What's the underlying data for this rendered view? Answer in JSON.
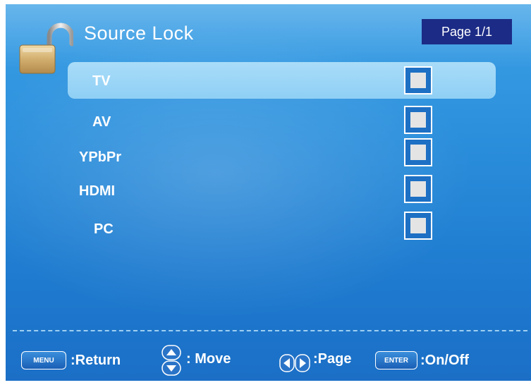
{
  "header": {
    "title": "Source Lock",
    "page_indicator": "Page 1/1"
  },
  "sources": [
    {
      "label": "TV",
      "selected": true,
      "locked": false
    },
    {
      "label": "AV",
      "selected": false,
      "locked": false
    },
    {
      "label": "YPbPr",
      "selected": false,
      "locked": false
    },
    {
      "label": "HDMI",
      "selected": false,
      "locked": false
    },
    {
      "label": "PC",
      "selected": false,
      "locked": false
    }
  ],
  "footer": {
    "menu_key": "MENU",
    "menu_action": ":Return",
    "move_action": ": Move",
    "page_action": ":Page",
    "enter_key": "ENTER",
    "enter_action": ":On/Off"
  },
  "colors": {
    "background": "#2b8fdc",
    "selection": "#a9dcf8",
    "badge": "#1c2b86"
  },
  "icons": [
    "padlock-icon",
    "up-down-arrows-icon",
    "left-right-arrows-icon"
  ]
}
